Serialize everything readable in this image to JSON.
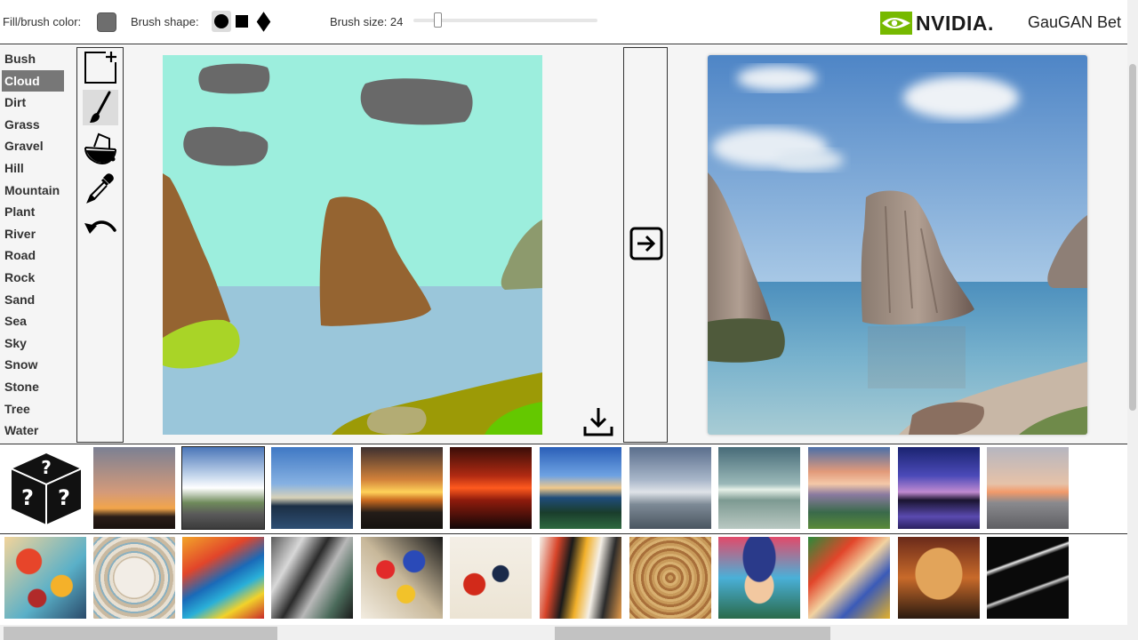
{
  "toolbar": {
    "fill_label": "Fill/brush color:",
    "fill_color": "#6e6e6e",
    "shape_label": "Brush shape:",
    "shapes": [
      "circle",
      "square",
      "diamond"
    ],
    "selected_shape": "circle",
    "brush_size_label": "Brush size: 24",
    "brush_size_value": 24,
    "brush_size_min": 1,
    "brush_size_max": 200
  },
  "brand": {
    "logo_text": "NVIDIA.",
    "logo_color": "#76b900",
    "app_title": "GauGAN Bet"
  },
  "labels": {
    "selected": "Cloud",
    "items": [
      "Bush",
      "Cloud",
      "Dirt",
      "Grass",
      "Gravel",
      "Hill",
      "Mountain",
      "Plant",
      "River",
      "Road",
      "Rock",
      "Sand",
      "Sea",
      "Sky",
      "Snow",
      "Stone",
      "Tree",
      "Water"
    ]
  },
  "tools": {
    "items": [
      "new-canvas-icon",
      "paintbrush-icon",
      "paint-bucket-icon",
      "eyedropper-icon",
      "undo-icon"
    ],
    "selected": "paintbrush-icon"
  },
  "actions": {
    "download_icon": "download-icon",
    "generate_icon": "arrow-right-box-icon"
  },
  "segmentation_colors": {
    "sky": "#9ceedd",
    "sea": "#9ac6da",
    "cloud": "#696969",
    "rock": "#956431",
    "bush": "#a9d427",
    "grass": "#9c9a06",
    "plant": "#64c800",
    "hill": "#8d9a6d",
    "sand": "#b3ac74"
  },
  "style_rows": {
    "random_icon": "dice-icon",
    "photo_thumbnails": 11,
    "painting_thumbnails": 12,
    "selected_photo": 2
  }
}
